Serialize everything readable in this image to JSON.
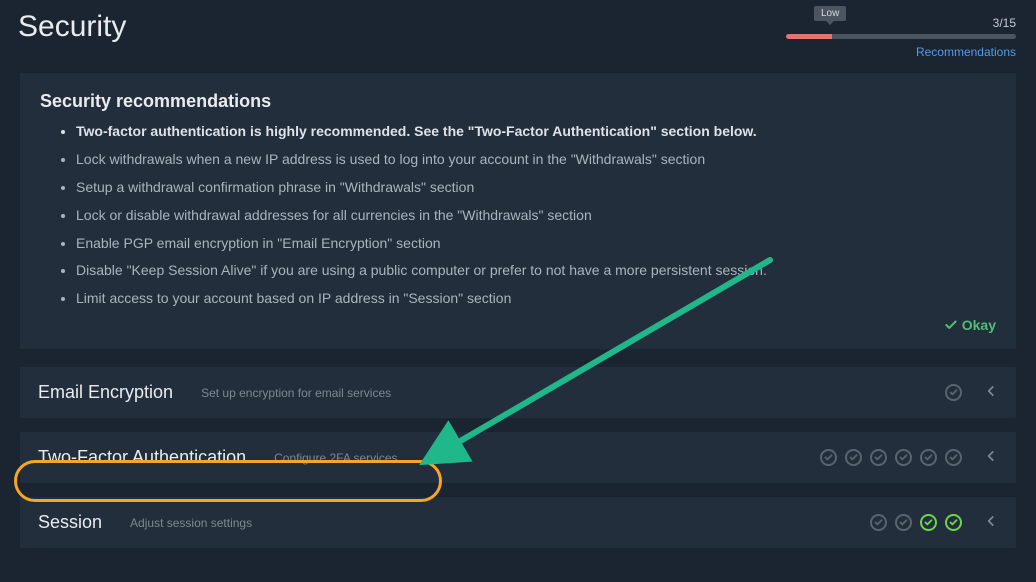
{
  "header": {
    "title": "Security",
    "score_label": "Low",
    "score_text": "3/15",
    "score_percent": 20,
    "recommendations_link": "Recommendations"
  },
  "recommendations": {
    "title": "Security recommendations",
    "items": [
      {
        "text": "Two-factor authentication is highly recommended. See the \"Two-Factor Authentication\" section below.",
        "bold": true
      },
      {
        "text": "Lock withdrawals when a new IP address is used to log into your account in the \"Withdrawals\" section",
        "bold": false
      },
      {
        "text": "Setup a withdrawal confirmation phrase in \"Withdrawals\" section",
        "bold": false
      },
      {
        "text": "Lock or disable withdrawal addresses for all currencies in the \"Withdrawals\" section",
        "bold": false
      },
      {
        "text": "Enable PGP email encryption in \"Email Encryption\" section",
        "bold": false
      },
      {
        "text": "Disable \"Keep Session Alive\" if you are using a public computer or prefer to not have a more persistent session.",
        "bold": false
      },
      {
        "text": "Limit access to your account based on IP address in \"Session\" section",
        "bold": false
      }
    ],
    "okay_label": "Okay"
  },
  "sections": [
    {
      "title": "Email Encryption",
      "subtitle": "Set up encryption for email services",
      "statuses": [
        "off"
      ]
    },
    {
      "title": "Two-Factor Authentication",
      "subtitle": "Configure 2FA services",
      "statuses": [
        "off",
        "off",
        "off",
        "off",
        "off",
        "off"
      ]
    },
    {
      "title": "Session",
      "subtitle": "Adjust session settings",
      "statuses": [
        "off",
        "off",
        "on",
        "on"
      ]
    }
  ],
  "colors": {
    "accent_green": "#4fbf77",
    "highlight": "#f5a623",
    "arrow": "#20b88a",
    "bar_low": "#e57373"
  }
}
